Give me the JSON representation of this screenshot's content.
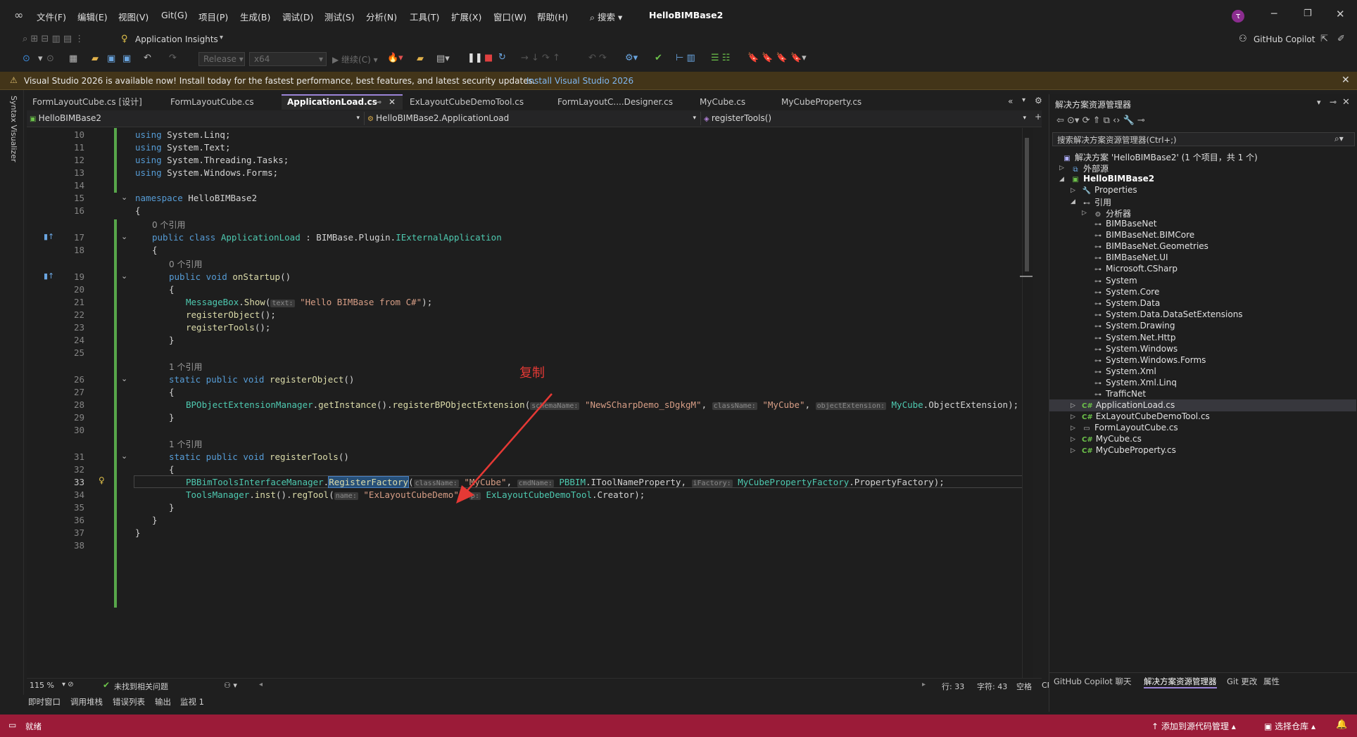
{
  "menubar": {
    "items": [
      "文件(F)",
      "编辑(E)",
      "视图(V)",
      "Git(G)",
      "项目(P)",
      "生成(B)",
      "调试(D)",
      "测试(S)",
      "分析(N)",
      "工具(T)",
      "扩展(X)",
      "窗口(W)",
      "帮助(H)"
    ],
    "search": "搜索",
    "title": "HelloBIMBase2",
    "avatar": "τ"
  },
  "toolbar1": {
    "insights": "Application Insights",
    "copilot": "GitHub Copilot"
  },
  "toolbar2": {
    "config": "Release",
    "platform": "x64",
    "continue": "继续(C)"
  },
  "infobar": {
    "message": "Visual Studio 2026 is available now! Install today for the fastest performance, best features, and latest security updates.",
    "link": "Install Visual Studio 2026"
  },
  "leftstrip": {
    "label": "Syntax Visualizer"
  },
  "tabs": [
    "FormLayoutCube.cs [设计]",
    "FormLayoutCube.cs",
    "ApplicationLoad.cs",
    "ExLayoutCubeDemoTool.cs",
    "FormLayoutC....Designer.cs",
    "MyCube.cs",
    "MyCubeProperty.cs"
  ],
  "navbar": {
    "project": "HelloBIMBase2",
    "class": "HelloBIMBase2.ApplicationLoad",
    "member": "registerTools()"
  },
  "editor": {
    "refs": {
      "r17": "0 个引用",
      "r19": "0 个引用",
      "r26": "1 个引用",
      "r31": "1 个引用"
    },
    "lines": [
      "10",
      "11",
      "12",
      "13",
      "14",
      "15",
      "16",
      "17",
      "18",
      "19",
      "20",
      "21",
      "22",
      "23",
      "24",
      "25",
      "26",
      "27",
      "28",
      "29",
      "30",
      "31",
      "32",
      "33",
      "34",
      "35",
      "36",
      "37",
      "38"
    ],
    "annotation": "复制"
  },
  "statusline": {
    "zoom": "115 %",
    "issues": "未找到相关问题",
    "line": "行: 33",
    "col": "字符: 43",
    "space": "空格",
    "eol": "CRLF"
  },
  "bottomtabs": [
    "即时窗口",
    "调用堆栈",
    "错误列表",
    "输出",
    "监视 1"
  ],
  "statusbar": {
    "ready": "就绪",
    "add_source": "添加到源代码管理",
    "select_repo": "选择仓库"
  },
  "solution": {
    "title": "解决方案资源管理器",
    "search_placeholder": "搜索解决方案资源管理器(Ctrl+;)",
    "root": "解决方案 'HelloBIMBase2' (1 个项目，共 1 个)",
    "external": "外部源",
    "project": "HelloBIMBase2",
    "properties": "Properties",
    "references": "引用",
    "analyzers": "分析器",
    "refs": [
      "BIMBaseNet",
      "BIMBaseNet.BIMCore",
      "BIMBaseNet.Geometries",
      "BIMBaseNet.UI",
      "Microsoft.CSharp",
      "System",
      "System.Core",
      "System.Data",
      "System.Data.DataSetExtensions",
      "System.Drawing",
      "System.Net.Http",
      "System.Windows",
      "System.Windows.Forms",
      "System.Xml",
      "System.Xml.Linq",
      "TrafficNet"
    ],
    "files": [
      "ApplicationLoad.cs",
      "ExLayoutCubeDemoTool.cs",
      "FormLayoutCube.cs",
      "MyCube.cs",
      "MyCubeProperty.cs"
    ],
    "bottom_tabs": [
      "GitHub Copilot 聊天",
      "解决方案资源管理器",
      "Git 更改",
      "属性"
    ]
  }
}
